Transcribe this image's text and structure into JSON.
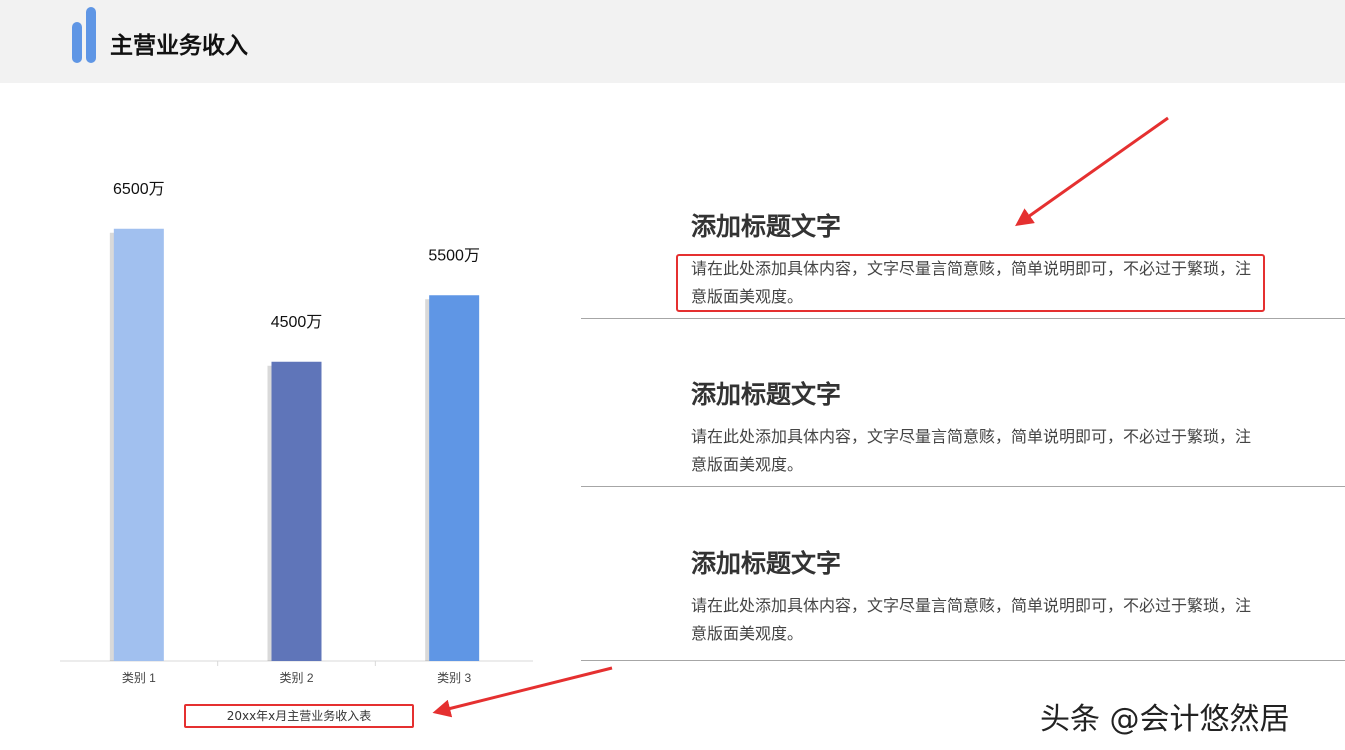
{
  "header": {
    "title": "主营业务收入"
  },
  "chart_data": {
    "type": "bar",
    "categories": [
      "类别 1",
      "类别 2",
      "类别 3"
    ],
    "values": [
      6500,
      4500,
      5500
    ],
    "data_labels": [
      "6500万",
      "4500万",
      "5500万"
    ],
    "colors": [
      "#a1c0ef",
      "#5f75b9",
      "#5f96e5"
    ],
    "unit": "万",
    "ylim": [
      0,
      8000
    ],
    "grid": false,
    "title": "20xx年x月主营业务收入表"
  },
  "items": [
    {
      "title": "添加标题文字",
      "body": "请在此处添加具体内容，文字尽量言简意赅，简单说明即可，不必过于繁琐，注意版面美观度。"
    },
    {
      "title": "添加标题文字",
      "body": "请在此处添加具体内容，文字尽量言简意赅，简单说明即可，不必过于繁琐，注意版面美观度。"
    },
    {
      "title": "添加标题文字",
      "body": "请在此处添加具体内容，文字尽量言简意赅，简单说明即可，不必过于繁琐，注意版面美观度。"
    }
  ],
  "watermark": "头条 @会计悠然居",
  "colors": {
    "accent": "#5f96e5",
    "annotation": "#e53030",
    "header_bg": "#f2f2f2"
  }
}
